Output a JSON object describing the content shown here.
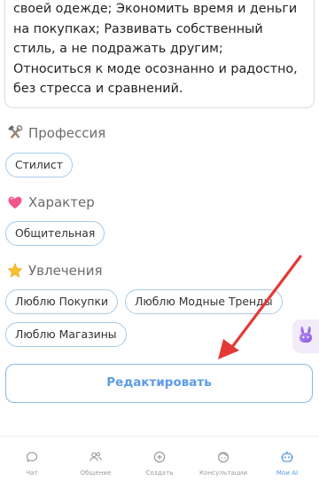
{
  "description": {
    "text": "своей одежде; Экономить время и деньги на покупках; Развивать собственный стиль, а не подражать другим; Относиться к моде осознанно и радостно, без стресса и сравнений."
  },
  "profession": {
    "icon": "hammer-wrench-icon",
    "title": "Профессия",
    "tags": [
      "Стилист"
    ]
  },
  "character": {
    "icon": "pink-heart-icon",
    "title": "Характер",
    "tags": [
      "Общительная"
    ]
  },
  "hobbies": {
    "icon": "star-icon",
    "title": "Увлечения",
    "tags": [
      "Люблю Покупки",
      "Люблю Модные Тренды",
      "Люблю Магазины"
    ]
  },
  "edit_button": {
    "label": "Редактировать"
  },
  "annotation": {
    "color": "#e53935"
  },
  "tabbar": {
    "active_color": "#5b9be6",
    "items": [
      {
        "label": "Чат",
        "icon": "chat-bubble-icon"
      },
      {
        "label": "Общение",
        "icon": "people-icon"
      },
      {
        "label": "Создать",
        "icon": "plus-circle-icon"
      },
      {
        "label": "Консультации",
        "icon": "face-icon"
      },
      {
        "label": "Мои AI",
        "icon": "robot-icon"
      }
    ]
  }
}
